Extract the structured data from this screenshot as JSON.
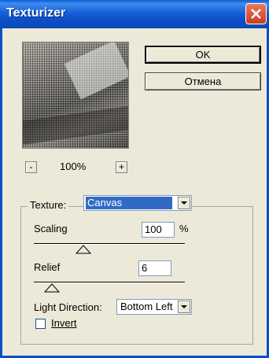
{
  "window": {
    "title": "Texturizer"
  },
  "preview": {
    "zoom_out_label": "-",
    "zoom_in_label": "+",
    "zoom_value": "100%"
  },
  "buttons": {
    "ok": "OK",
    "cancel": "Отмена"
  },
  "texture": {
    "label": "Texture:",
    "selected": "Canvas"
  },
  "scaling": {
    "label": "Scaling",
    "value": "100",
    "unit": "%"
  },
  "relief": {
    "label": "Relief",
    "value": "6"
  },
  "light_direction": {
    "label": "Light Direction:",
    "selected": "Bottom Left"
  },
  "invert": {
    "label": "Invert",
    "checked": false
  },
  "colors": {
    "title_bar": "#0b4fc8",
    "dialog_bg": "#ece9d8",
    "selection": "#316ac5",
    "close": "#c8401f"
  }
}
